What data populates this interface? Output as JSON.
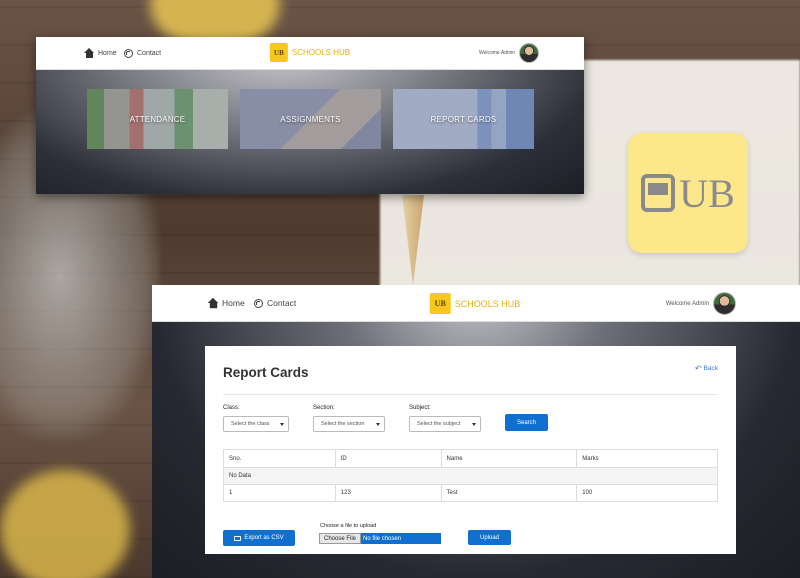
{
  "header": {
    "home_label": "Home",
    "contact_label": "Contact",
    "brand_logo_text": "UB",
    "brand_name": "SCHOOLS HUB",
    "welcome_text": "Welcome Admin"
  },
  "dashboard": {
    "tiles": [
      {
        "label": "ATTENDANCE"
      },
      {
        "label": "ASSIGNMENTS"
      },
      {
        "label": "REPORT CARDS"
      }
    ]
  },
  "background": {
    "logo_text": "UB"
  },
  "report_cards": {
    "title": "Report Cards",
    "back_label": "Back",
    "filters": {
      "class_label": "Class:",
      "class_value": "Select the class",
      "section_label": "Section:",
      "section_value": "Select the section",
      "subject_label": "Subject:",
      "subject_value": "Select the subject",
      "search_label": "Search"
    },
    "table": {
      "columns": [
        "Sno.",
        "ID",
        "Name",
        "Marks"
      ],
      "empty_text": "No Data",
      "rows": [
        [
          "1",
          "123",
          "Test",
          "100"
        ]
      ]
    },
    "export_label": "Export as CSV",
    "upload_prompt": "Choose a file to upload",
    "choose_file_label": "Choose File",
    "file_status": "No file chosen",
    "upload_label": "Upload"
  },
  "colors": {
    "brand_yellow": "#f7c71c",
    "primary_blue": "#1170cf",
    "link_blue": "#3a7bd5"
  }
}
